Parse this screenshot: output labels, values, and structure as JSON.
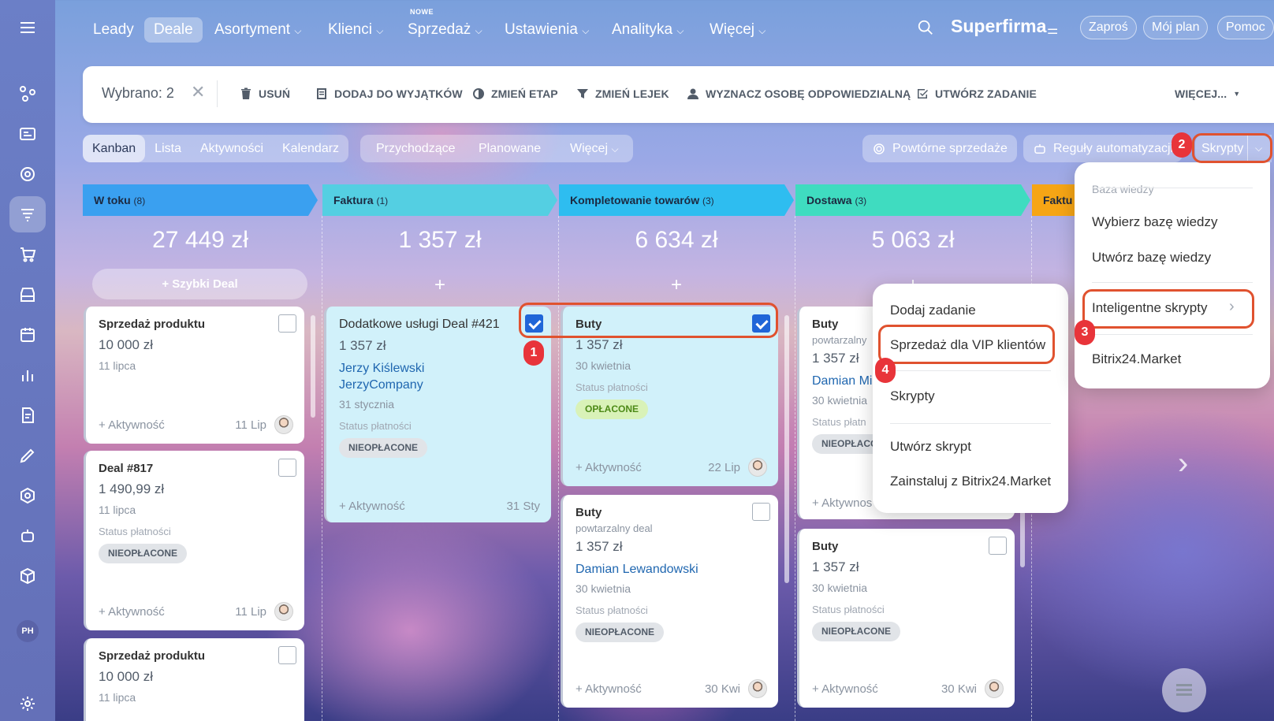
{
  "nav": {
    "items": [
      "Leady",
      "Deale",
      "Asortyment",
      "Klienci",
      "Sprzedaż",
      "Ustawienia",
      "Analityka",
      "Więcej"
    ],
    "badge": "NOWE",
    "brand": "Superfirma",
    "pills": [
      "Zaproś",
      "Mój plan",
      "Pomoc"
    ]
  },
  "actionbar": {
    "selected": "Wybrano: 2",
    "delete": "USUŃ",
    "exceptions": "DODAJ DO WYJĄTKÓW",
    "stage": "ZMIEŃ ETAP",
    "funnel": "ZMIEŃ LEJEK",
    "assign": "WYZNACZ OSOBĘ ODPOWIEDZIALNĄ",
    "task": "UTWÓRZ ZADANIE",
    "more": "WIĘCEJ..."
  },
  "views": [
    "Kanban",
    "Lista",
    "Aktywności",
    "Kalendarz"
  ],
  "filters": [
    "Przychodzące",
    "Planowane",
    "Więcej"
  ],
  "toolbar": {
    "repeat": "Powtórne sprzedaże",
    "rules": "Reguły automatyzacji",
    "scripts": "Skrypty"
  },
  "steps": [
    "1",
    "2",
    "3",
    "4"
  ],
  "sidebar": {
    "avatar": "PH"
  },
  "columns": [
    {
      "name": "W toku",
      "count": "(8)",
      "sum": "27 449 zł",
      "color": "#3aa0f0"
    },
    {
      "name": "Faktura",
      "count": "(1)",
      "sum": "1 357 zł",
      "color": "#54cfe2"
    },
    {
      "name": "Kompletowanie towarów",
      "count": "(3)",
      "sum": "6 634 zł",
      "color": "#2ebdf0"
    },
    {
      "name": "Dostawa",
      "count": "(3)",
      "sum": "5 063 zł",
      "color": "#3fdcc0"
    },
    {
      "name": "Faktu",
      "count": "",
      "sum": "",
      "color": "#f6a515"
    }
  ],
  "quick_deal": "Szybki Deal",
  "plus": "+",
  "cards": {
    "c1": {
      "title": "Sprzedaż produktu",
      "amount": "10 000 zł",
      "date": "11 lipca",
      "activity": "+ Aktywność",
      "short": "11 Lip"
    },
    "c2": {
      "title": "Deal #817",
      "amount": "1 490,99 zł",
      "date": "11 lipca",
      "status_label": "Status płatności",
      "status": "NIEOPŁACONE",
      "activity": "+ Aktywność",
      "short": "11 Lip"
    },
    "c3": {
      "title": "Sprzedaż produktu",
      "amount": "10 000 zł",
      "date": "11 lipca"
    },
    "c4": {
      "title": "Dodatkowe usługi Deal #421",
      "amount": "1 357 zł",
      "contact": "Jerzy Kiślewski",
      "company": "JerzyCompany",
      "date": "31 stycznia",
      "status_label": "Status płatności",
      "status": "NIEOPŁACONE",
      "activity": "+ Aktywność",
      "short": "31 Sty"
    },
    "c5": {
      "title": "Buty",
      "amount": "1 357 zł",
      "date": "30 kwietnia",
      "status_label": "Status płatności",
      "status": "OPŁACONE",
      "activity": "+ Aktywność",
      "short": "22 Lip"
    },
    "c6": {
      "title": "Buty",
      "sub": "powtarzalny deal",
      "amount": "1 357 zł",
      "contact": "Damian Lewandowski",
      "date": "30 kwietnia",
      "status_label": "Status płatności",
      "status": "NIEOPŁACONE",
      "activity": "+ Aktywność",
      "short": "30 Kwi"
    },
    "c7": {
      "title": "Buty",
      "sub": "powtarzalny",
      "amount": "1 357 zł",
      "contact": "Damian Mi",
      "date": "30 kwietnia",
      "status_label": "Status płatn",
      "status": "NIEOPŁACO",
      "activity": "+ Aktywnos"
    },
    "c8": {
      "title": "Buty",
      "amount": "1 357 zł",
      "date": "30 kwietnia",
      "status_label": "Status płatności",
      "status": "NIEOPŁACONE",
      "activity": "+ Aktywność",
      "short": "30 Kwi"
    }
  },
  "menu_main": {
    "header": "Baza wiedzy",
    "items": [
      "Wybierz bazę wiedzy",
      "Utwórz bazę wiedzy",
      "Inteligentne skrypty",
      "Bitrix24.Market"
    ]
  },
  "menu_sub": {
    "items": [
      "Dodaj zadanie",
      "Sprzedaż dla VIP klientów",
      "Skrypty",
      "Utwórz skrypt",
      "Zainstaluj z Bitrix24.Market"
    ]
  }
}
